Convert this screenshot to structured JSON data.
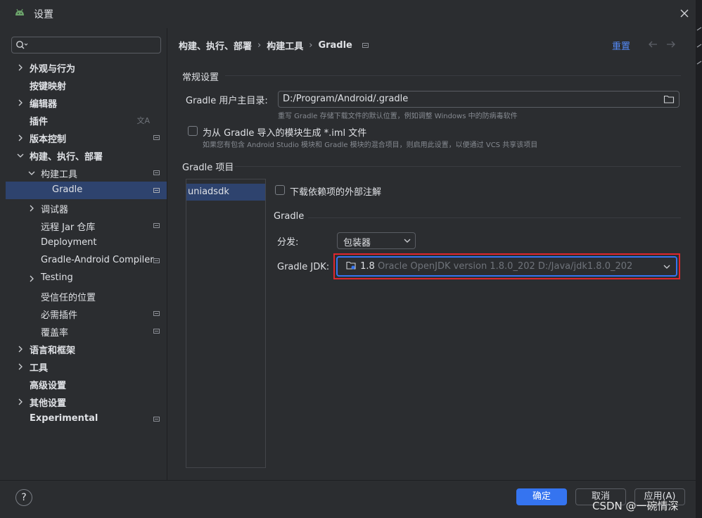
{
  "window": {
    "title": "设置"
  },
  "search": {
    "placeholder": ""
  },
  "sidebar": {
    "items": [
      {
        "label": "外观与行为"
      },
      {
        "label": "按键映射"
      },
      {
        "label": "编辑器"
      },
      {
        "label": "插件"
      },
      {
        "label": "版本控制"
      },
      {
        "label": "构建、执行、部署"
      },
      {
        "label": "构建工具"
      },
      {
        "label": "Gradle"
      },
      {
        "label": "调试器"
      },
      {
        "label": "远程 Jar 仓库"
      },
      {
        "label": "Deployment"
      },
      {
        "label": "Gradle-Android Compiler"
      },
      {
        "label": "Testing"
      },
      {
        "label": "受信任的位置"
      },
      {
        "label": "必需插件"
      },
      {
        "label": "覆盖率"
      },
      {
        "label": "语言和框架"
      },
      {
        "label": "工具"
      },
      {
        "label": "高级设置"
      },
      {
        "label": "其他设置"
      },
      {
        "label": "Experimental"
      }
    ]
  },
  "breadcrumb": {
    "level1": "构建、执行、部署",
    "level2": "构建工具",
    "level3": "Gradle"
  },
  "header": {
    "reset_label": "重置"
  },
  "general": {
    "section_title": "常规设置",
    "home_label": "Gradle 用户主目录:",
    "home_value": "D:/Program/Android/.gradle",
    "home_hint": "重写 Gradle 存储下载文件的默认位置，例如调整 Windows 中的防病毒软件",
    "iml_label": "为从 Gradle 导入的模块生成 *.iml 文件",
    "iml_hint": "如果您有包含 Android Studio 模块和 Gradle 模块的混合项目，则启用此设置，以便通过 VCS 共享该项目"
  },
  "projects": {
    "section_title": "Gradle 项目",
    "items": [
      "uniadsdk"
    ],
    "download_annotations_label": "下载依赖项的外部注解"
  },
  "gradle": {
    "section_title": "Gradle",
    "distribution_label": "分发:",
    "distribution_value": "包装器",
    "jdk_label": "Gradle JDK:",
    "jdk_version": "1.8",
    "jdk_desc": "Oracle OpenJDK version 1.8.0_202 D:/Java/jdk1.8.0_202"
  },
  "footer": {
    "help": "?",
    "ok": "确定",
    "cancel": "取消",
    "apply": "应用(A)"
  },
  "watermark": "CSDN @一碗情深",
  "background_text": "                                                                                                "
}
